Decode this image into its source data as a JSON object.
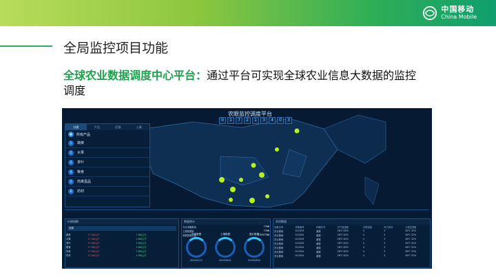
{
  "slide": {
    "brand_cn": "中国移动",
    "brand_en": "China Mobile",
    "title": "全局监控项目功能",
    "subtitle_highlight": "全球农业数据调度中心平台：",
    "subtitle_rest": "通过平台可实现全球农业信息大数据的监控调度"
  },
  "dashboard": {
    "title": "农眼监控调度平台",
    "counter_digits": [
      "0",
      "1",
      "7",
      "2",
      "1",
      "3",
      "4",
      "0",
      "3"
    ],
    "tabs": [
      "分类",
      "产品",
      "区域",
      "土壤"
    ],
    "all_products": "所有产品",
    "categories": [
      {
        "num": "1",
        "name": "蔬菜"
      },
      {
        "num": "2",
        "name": "水果"
      },
      {
        "num": "3",
        "name": "茶叶"
      },
      {
        "num": "4",
        "name": "粮食"
      },
      {
        "num": "5",
        "name": "肉禽蛋品"
      },
      {
        "num": "6",
        "name": "药材"
      }
    ],
    "panel_left_title": "价格指数",
    "panel_left_select": "全部",
    "panel_mid_title": "数据统计",
    "panel_mid_rows": [
      {
        "label": "今日采集数量",
        "value": "7786"
      },
      {
        "label": "上报数据量",
        "value": "7786"
      },
      {
        "label": "采集数据总量",
        "value": "37597786"
      }
    ],
    "gauges": [
      {
        "label": "气象数据",
        "value": "00004113"
      },
      {
        "label": "土壤数据",
        "value": "00003821"
      },
      {
        "label": "图片数据",
        "value": "00002654"
      }
    ],
    "panel_right_title": "实时数据",
    "right_header": [
      "设备名称",
      "采集编号",
      "种植情况",
      "空气温湿度",
      "光照强度",
      "风力风向",
      "土壤温湿度"
    ],
    "right_rows": [
      [
        "农业基地",
        "012034",
        "蔬菜",
        "26℃ 62%",
        "4",
        "3",
        "18℃ 32%"
      ],
      [
        "农业基地",
        "012034",
        "蔬菜",
        "26℃ 62%",
        "4",
        "3",
        "18℃ 32%"
      ],
      [
        "农业基地",
        "012034",
        "蔬菜",
        "26℃ 62%",
        "4",
        "3",
        "18℃ 32%"
      ],
      [
        "农业基地",
        "012034",
        "蔬菜",
        "26℃ 62%",
        "4",
        "3",
        "18℃ 32%"
      ],
      [
        "农业基地",
        "012034",
        "蔬菜",
        "26℃ 62%",
        "4",
        "3",
        "18℃ 32%"
      ],
      [
        "农业基地",
        "012034",
        "蔬菜",
        "26℃ 62%",
        "4",
        "3",
        "18℃ 32%"
      ],
      [
        "农业基地",
        "012034",
        "蔬菜",
        "26℃ 62%",
        "4",
        "3",
        "18℃ 32%"
      ]
    ],
    "price_rows": [
      {
        "name": "蔬菜",
        "a": "17.00/公斤",
        "b": "1.68/公斤"
      },
      {
        "name": "水果",
        "a": "17.00/公斤",
        "b": "1.68/公斤"
      },
      {
        "name": "茶叶",
        "a": "17.00/公斤",
        "b": "1.68/公斤"
      },
      {
        "name": "粮食",
        "a": "17.00/公斤",
        "b": "1.68/公斤"
      },
      {
        "name": "肉禽",
        "a": "17.00/公斤",
        "b": "1.68/公斤"
      },
      {
        "name": "药材",
        "a": "17.00/公斤",
        "b": "1.68/公斤"
      }
    ]
  },
  "colors": {
    "accent_green": "#1aa34a",
    "dash_bg": "#061a33",
    "marker": "#b5f21f"
  }
}
